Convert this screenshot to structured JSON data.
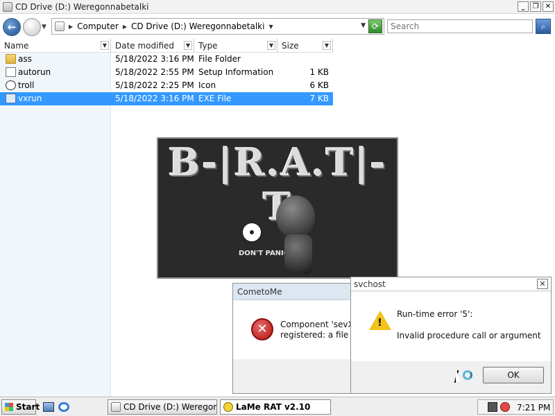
{
  "window": {
    "title": "CD Drive (D:) Weregonnabetalki",
    "buttons": {
      "minimize": "_",
      "maximize": "❐",
      "close": "✕"
    }
  },
  "nav": {
    "back_glyph": "←",
    "breadcrumb": [
      "Computer",
      "CD Drive (D:) Weregonnabetalki"
    ],
    "search_placeholder": "Search",
    "search_glyph": "⌕",
    "refresh_glyph": "⟳"
  },
  "columns": [
    "Name",
    "Date modified",
    "Type",
    "Size"
  ],
  "files": [
    {
      "name": "ass",
      "date": "5/18/2022 3:16 PM",
      "type": "File Folder",
      "size": "",
      "icon": "folder-icon"
    },
    {
      "name": "autorun",
      "date": "5/18/2022 2:55 PM",
      "type": "Setup Information",
      "size": "1 KB",
      "icon": "setup-info-icon"
    },
    {
      "name": "troll",
      "date": "5/18/2022 2:25 PM",
      "type": "Icon",
      "size": "6 KB",
      "icon": "troll-icon"
    },
    {
      "name": "vxrun",
      "date": "5/18/2022 3:16 PM",
      "type": "EXE File",
      "size": "7 KB",
      "icon": "exe-icon",
      "selected": true
    }
  ],
  "splash": {
    "logo_text": "B-|R.A.T|-T",
    "caption": "DON'T PANIC"
  },
  "dialog_cometome": {
    "title": "CometoMe",
    "message_line1": "Component 'sevXP",
    "message_line2": "registered: a file is r",
    "icon": "error-icon"
  },
  "dialog_svchost": {
    "title": "svchost",
    "line1": "Run-time error '5':",
    "line2": "Invalid procedure call or argument",
    "ok_label": "OK",
    "close_glyph": "✕",
    "icon": "warning-icon"
  },
  "taskbar": {
    "start_label": "Start",
    "tasks": [
      {
        "label": "CD Drive (D:) Weregon...",
        "icon": "folder-icon"
      },
      {
        "label": "LaMe RAT v2.10",
        "icon": "smiley-icon",
        "active": true
      }
    ],
    "clock": "7:21 PM"
  },
  "colors": {
    "selection": "#3399ff",
    "left_pane": "#f1f6fb",
    "splash_bg": "#2a2a2a"
  }
}
